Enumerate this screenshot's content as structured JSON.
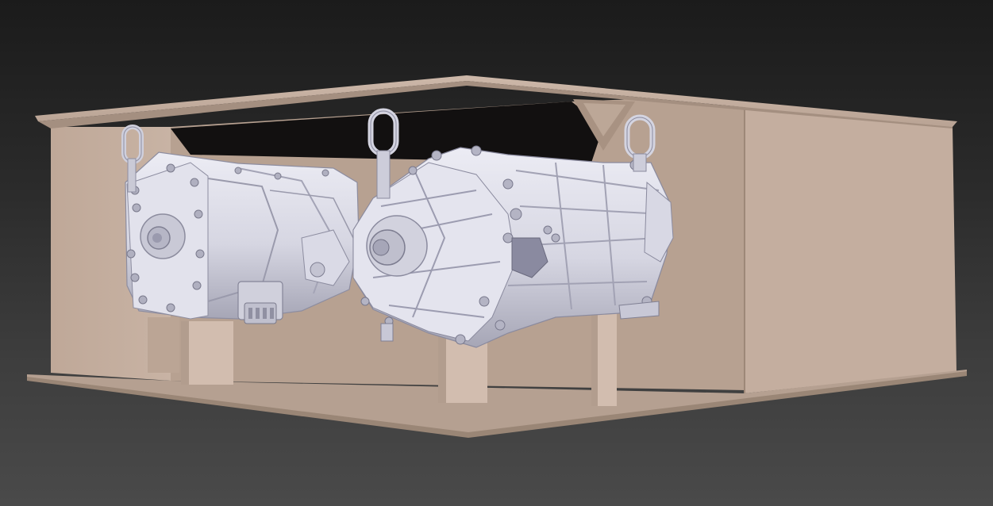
{
  "viewport": {
    "background_top": "#1b1b1b",
    "background_bottom": "#4a4a4a"
  },
  "scene": {
    "crate_color": "#c4ae9f",
    "crate_shadow_color": "#a99484",
    "crate_dark_color": "#8f7c6e",
    "housing_color": "#dcdce8",
    "housing_shadow_color": "#a8a8b8",
    "housing_dark_color": "#7e7e90",
    "objects": [
      "shipping-crate",
      "gearbox-housing-left",
      "gearbox-housing-right",
      "lifting-eye"
    ]
  }
}
